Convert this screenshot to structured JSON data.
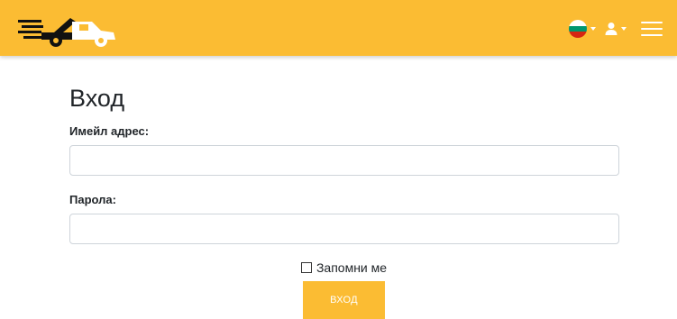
{
  "header": {
    "brand_color": "#fbbc33",
    "logo_icon": "tow-truck-logo-icon",
    "language_flag": "bulgaria-flag-icon",
    "user_icon": "user-icon",
    "menu_icon": "hamburger-menu-icon"
  },
  "login": {
    "title": "Вход",
    "email_label": "Имейл адрес:",
    "email_value": "",
    "password_label": "Парола:",
    "password_value": "",
    "remember_label": "Запомни ме",
    "remember_checked": false,
    "submit_label": "вход"
  }
}
